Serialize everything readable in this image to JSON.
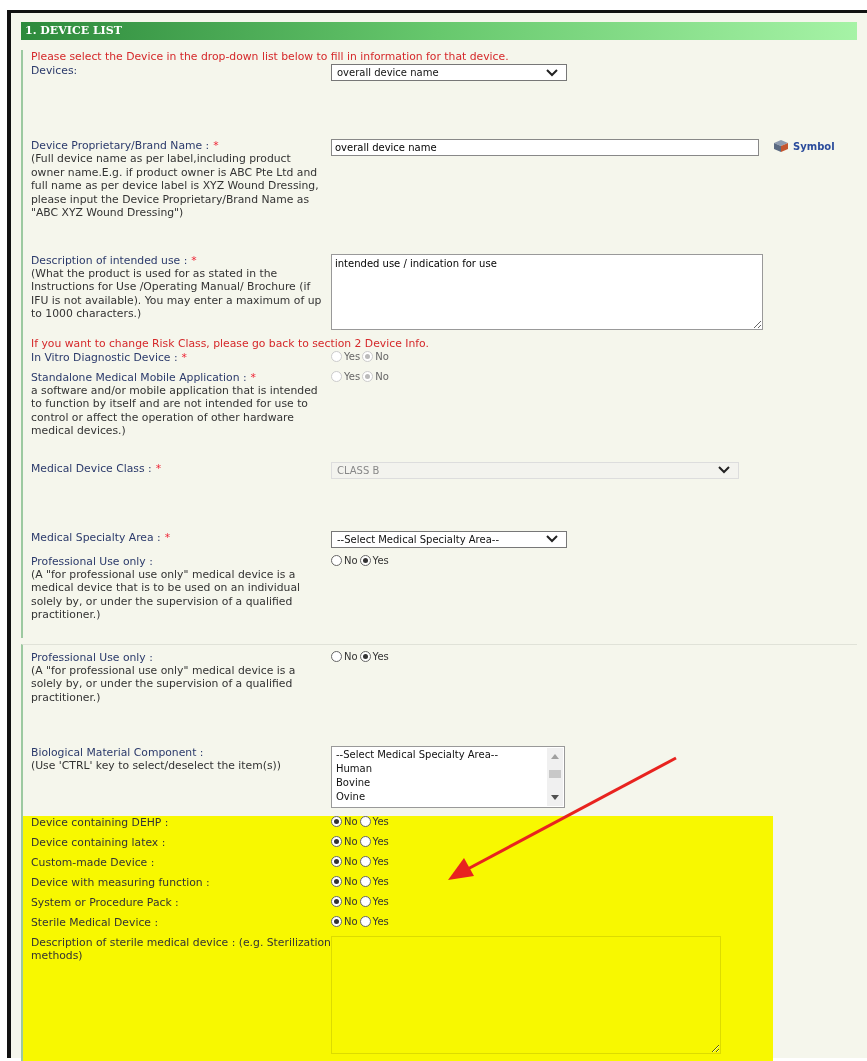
{
  "header": {
    "title": "1. DEVICE LIST"
  },
  "groups": [
    {
      "rows": [
        {
          "kind": "notice",
          "text": "Please select the Device in the drop-down list below to fill in information for that device."
        },
        {
          "kind": "select",
          "label": "Devices:",
          "value": "overall device name",
          "disabled": false
        },
        {
          "kind": "text",
          "label": "Device Proprietary/Brand Name :",
          "mark": "*",
          "hint": "(Full device name as per label,including product owner name.E.g. if product owner is ABC Pte Ltd and full name as per device label is XYZ Wound Dressing, please input the Device Proprietary/Brand Name as \"ABC XYZ Wound Dressing\")",
          "value": "overall device name",
          "link": "Symbol"
        },
        {
          "kind": "textarea",
          "label": "Description of intended use :",
          "mark": "*",
          "hint": "(What the product is used for as stated in the Instructions for Use /Operating Manual/ Brochure (if IFU is not available). You may enter a maximum of up to 1000 characters.)",
          "value": "intended use / indication for use"
        },
        {
          "kind": "notice",
          "text": "If you want to change Risk Class, please go back to section 2 Device Info."
        },
        {
          "kind": "radio",
          "label": "In Vitro Diagnostic Device :",
          "mark": "*",
          "disabled": true,
          "options": [
            {
              "label": "Yes",
              "selected": false
            },
            {
              "label": "No",
              "selected": true
            }
          ]
        },
        {
          "kind": "radio",
          "label": "Standalone Medical Mobile Application :",
          "mark": "*",
          "hint": "a software and/or mobile application that is intended to function by itself and are not intended for use to control or affect the operation of other hardware medical devices.)",
          "disabled": true,
          "options": [
            {
              "label": "Yes",
              "selected": false
            },
            {
              "label": "No",
              "selected": true
            }
          ]
        },
        {
          "kind": "select",
          "label": "Medical Device Class :",
          "mark": "*",
          "value": "CLASS B",
          "disabled": true
        },
        {
          "kind": "select",
          "label": "Medical Specialty Area :",
          "mark": "*",
          "value": "--Select Medical Specialty Area--",
          "disabled": false
        },
        {
          "kind": "radio",
          "label": "Professional Use only :",
          "hint": "(A \"for professional use only\" medical device is a medical device that is to be used on an individual solely by, or under the supervision of a qualified practitioner.)",
          "disabled": false,
          "options": [
            {
              "label": "No",
              "selected": false
            },
            {
              "label": "Yes",
              "selected": true
            }
          ]
        }
      ]
    },
    {
      "rows": [
        {
          "kind": "radio",
          "label": "Professional Use only :",
          "hint": "(A \"for professional use only\" medical device is a solely by, or under the supervision of a qualified practitioner.)",
          "disabled": false,
          "options": [
            {
              "label": "No",
              "selected": false
            },
            {
              "label": "Yes",
              "selected": true
            }
          ]
        },
        {
          "kind": "listbox",
          "label": "Biological Material Component :",
          "hint": "(Use 'CTRL' key to select/deselect the item(s))",
          "items": [
            "--Select Medical Specialty Area--",
            "Human",
            "Bovine",
            "Ovine"
          ]
        },
        {
          "kind": "radio",
          "label": "Device containing DEHP :",
          "highlighted": true,
          "disabled": false,
          "options": [
            {
              "label": "No",
              "selected": true
            },
            {
              "label": "Yes",
              "selected": false
            }
          ]
        },
        {
          "kind": "radio",
          "label": "Device containing latex :",
          "highlighted": true,
          "disabled": false,
          "options": [
            {
              "label": "No",
              "selected": true
            },
            {
              "label": "Yes",
              "selected": false
            }
          ]
        },
        {
          "kind": "radio",
          "label": "Custom-made Device :",
          "highlighted": true,
          "disabled": false,
          "options": [
            {
              "label": "No",
              "selected": true
            },
            {
              "label": "Yes",
              "selected": false
            }
          ]
        },
        {
          "kind": "radio",
          "label": "Device with measuring function :",
          "highlighted": true,
          "disabled": false,
          "options": [
            {
              "label": "No",
              "selected": true
            },
            {
              "label": "Yes",
              "selected": false
            }
          ]
        },
        {
          "kind": "radio",
          "label": "System or Procedure Pack :",
          "highlighted": true,
          "disabled": false,
          "options": [
            {
              "label": "No",
              "selected": true
            },
            {
              "label": "Yes",
              "selected": false
            }
          ]
        },
        {
          "kind": "radio",
          "label": "Sterile Medical Device :",
          "highlighted": true,
          "disabled": false,
          "options": [
            {
              "label": "No",
              "selected": true
            },
            {
              "label": "Yes",
              "selected": false
            }
          ]
        },
        {
          "kind": "textarea",
          "label": "Description of sterile medical device : (e.g. Sterilization methods)",
          "highlighted": true
        }
      ]
    }
  ]
}
